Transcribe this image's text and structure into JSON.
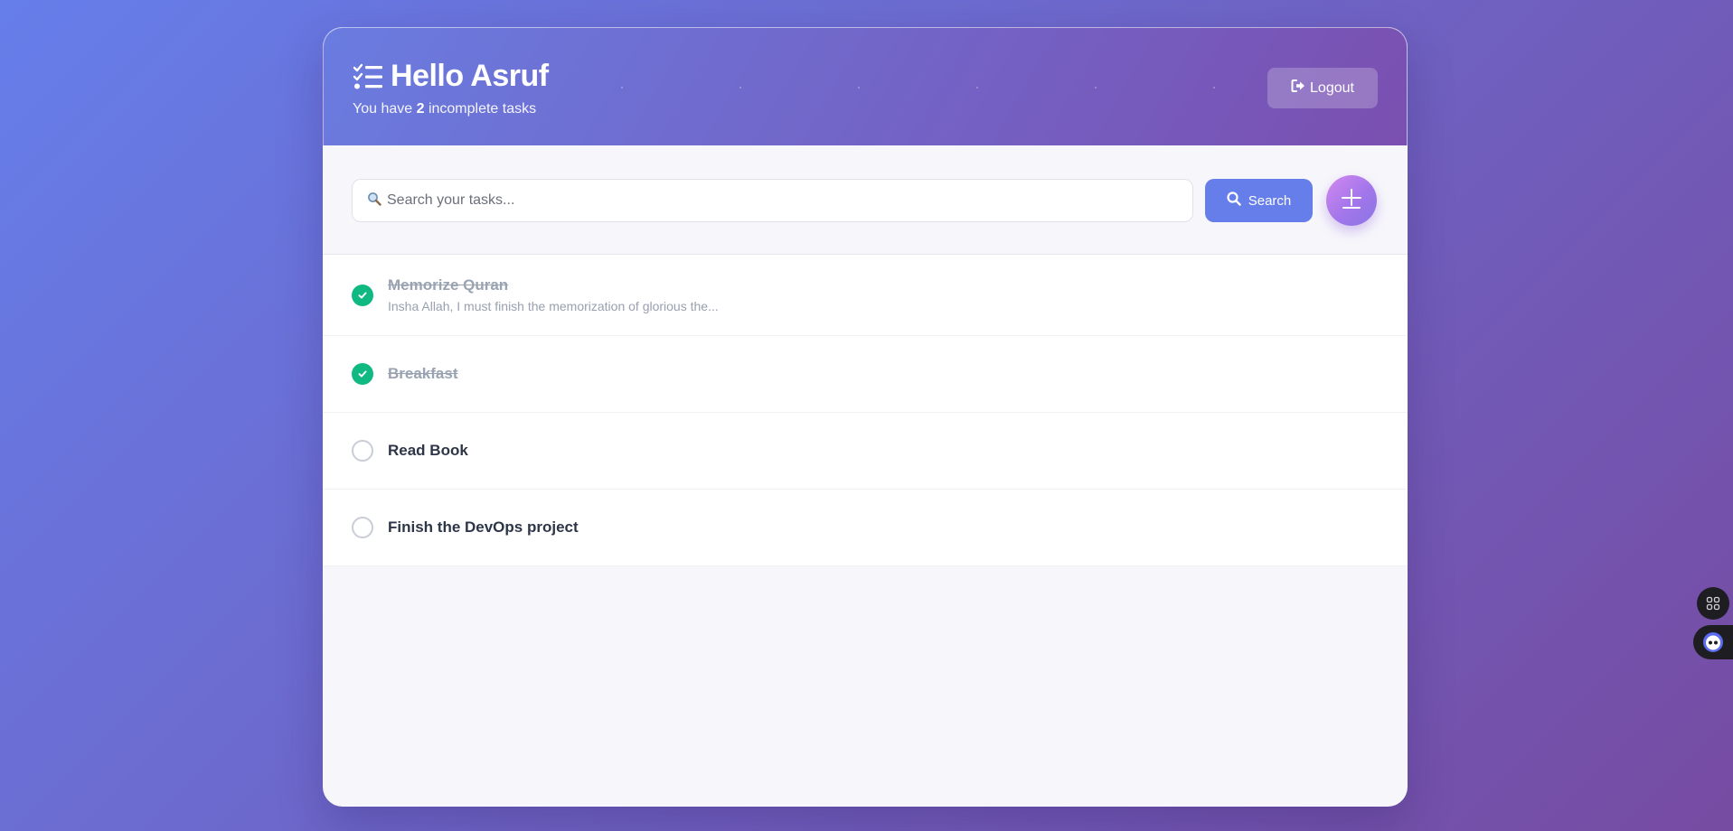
{
  "header": {
    "greeting": "Hello Asruf",
    "subtitle_prefix": "You have",
    "incomplete_count": "2",
    "subtitle_suffix": "incomplete tasks",
    "logout_label": "Logout"
  },
  "search": {
    "placeholder": "Search your tasks...",
    "value": "",
    "button_label": "Search"
  },
  "tasks": [
    {
      "title": "Memorize Quran",
      "description": "Insha Allah, I must finish the memorization of glorious the...",
      "completed": true
    },
    {
      "title": "Breakfast",
      "completed": true
    },
    {
      "title": "Read Book",
      "completed": false
    },
    {
      "title": "Finish the DevOps project",
      "completed": false
    }
  ],
  "colors": {
    "primary": "#667eea",
    "secondary": "#764ba2",
    "done": "#10b981"
  },
  "icons": {
    "title": "list-check-icon",
    "logout": "sign-out-icon",
    "search": "magnifier-icon",
    "add": "plus-icon",
    "widget1": "grid-icon",
    "widget2": "bot-icon"
  }
}
